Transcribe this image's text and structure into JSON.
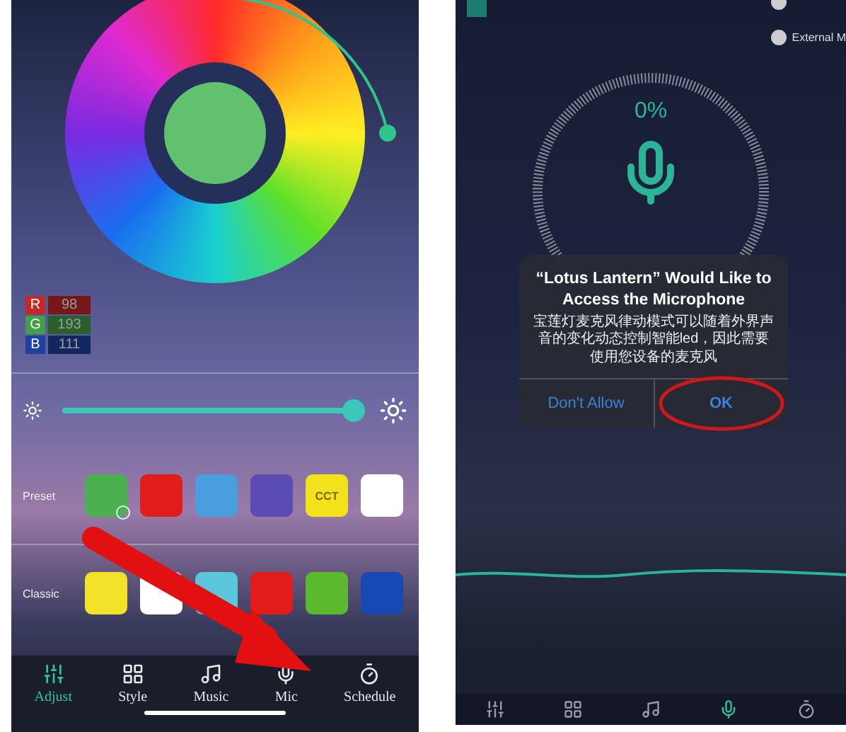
{
  "adjust_screen": {
    "rgb": [
      {
        "channel": "R",
        "value": "98",
        "color": "#c62828"
      },
      {
        "channel": "G",
        "value": "193",
        "color": "#43a047"
      },
      {
        "channel": "B",
        "value": "111",
        "color": "#1e40a0"
      }
    ],
    "brightness": {
      "level": 0.98
    },
    "preset": {
      "label": "Preset",
      "swatches": [
        {
          "color": "#4caf50",
          "selected": true
        },
        {
          "color": "#e21b1b",
          "selected": false
        },
        {
          "color": "#4a9ee0",
          "selected": false
        },
        {
          "color": "#5a4cb0",
          "selected": false
        },
        {
          "color": "#f2e21c",
          "selected": false,
          "text": "CCT"
        },
        {
          "color": "#ffffff",
          "selected": false
        }
      ]
    },
    "classic": {
      "label": "Classic",
      "swatches": [
        {
          "color": "#f2e22a"
        },
        {
          "color": "#ffffff"
        },
        {
          "color": "#5cc6dc"
        },
        {
          "color": "#e21b1b"
        },
        {
          "color": "#5cb82c"
        },
        {
          "color": "#1848b4"
        }
      ]
    },
    "tabs": [
      {
        "label": "Adjust",
        "selected": true
      },
      {
        "label": "Style",
        "selected": false
      },
      {
        "label": "Music",
        "selected": false
      },
      {
        "label": "Mic",
        "selected": false
      },
      {
        "label": "Schedule",
        "selected": false
      }
    ],
    "pointer_arrow": true
  },
  "mic_screen": {
    "reading": "0%",
    "option": "External M",
    "dialog": {
      "title": "“Lotus Lantern” Would Like to Access the Microphone",
      "message": "宝莲灯麦克风律动模式可以随着外界声音的变化动态控制智能led，因此需要使用您设备的麦克风",
      "buttons": [
        {
          "label": "Don't Allow",
          "circled": false
        },
        {
          "label": "OK",
          "circled": true
        }
      ]
    },
    "tabs": [
      {
        "selected": false
      },
      {
        "selected": false
      },
      {
        "selected": false
      },
      {
        "selected": true
      },
      {
        "selected": false
      }
    ]
  }
}
